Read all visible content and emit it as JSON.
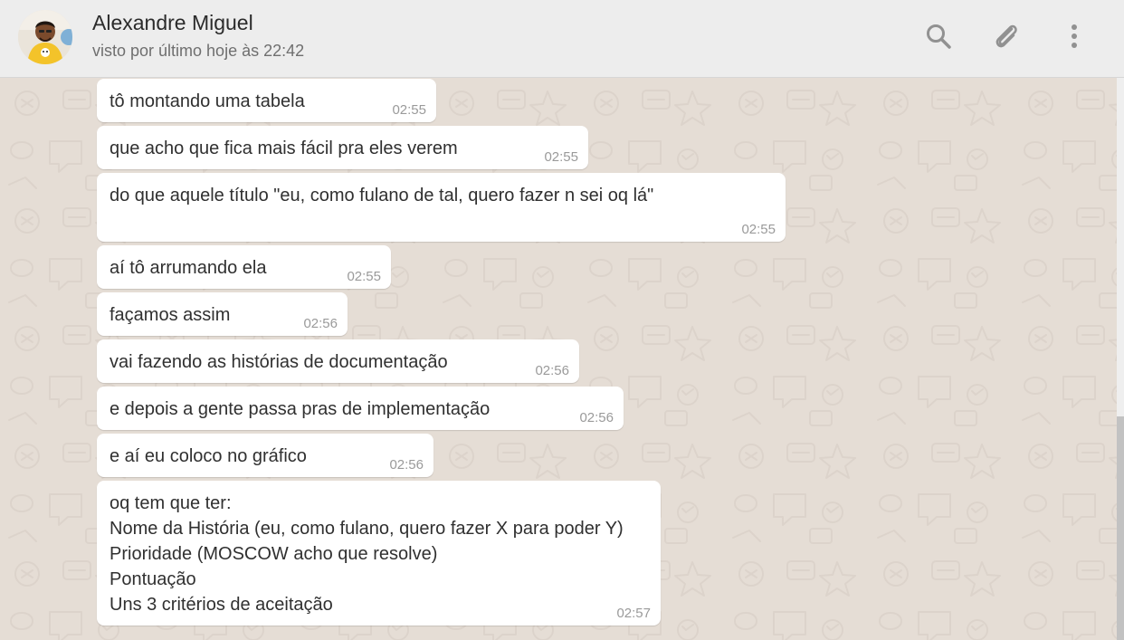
{
  "contact": {
    "name": "Alexandre Miguel",
    "status": "visto por último hoje às 22:42"
  },
  "icons": {
    "search": "search-icon",
    "attach": "paperclip-icon",
    "menu": "kebab-menu-icon"
  },
  "colors": {
    "header_bg": "#ededed",
    "chat_bg": "#e5ddd5",
    "bubble_bg": "#ffffff",
    "icon_gray": "#919191"
  },
  "messages": [
    {
      "text": "tô montando uma tabela",
      "time": "02:55"
    },
    {
      "text": "que acho que fica mais fácil pra eles verem",
      "time": "02:55"
    },
    {
      "text": "do que aquele título \"eu, como fulano de tal, quero fazer n sei oq lá\"",
      "time": "02:55"
    },
    {
      "text": "aí tô arrumando ela",
      "time": "02:55"
    },
    {
      "text": "façamos assim",
      "time": "02:56"
    },
    {
      "text": "vai fazendo as histórias de documentação",
      "time": "02:56"
    },
    {
      "text": "e depois a gente passa pras de implementação",
      "time": "02:56"
    },
    {
      "text": "e aí eu coloco no gráfico",
      "time": "02:56"
    },
    {
      "text": "oq tem que ter:\nNome da História (eu, como fulano, quero fazer X para poder Y)\nPrioridade (MOSCOW acho que resolve)\nPontuação\nUns 3 critérios de aceitação",
      "time": "02:57"
    }
  ]
}
